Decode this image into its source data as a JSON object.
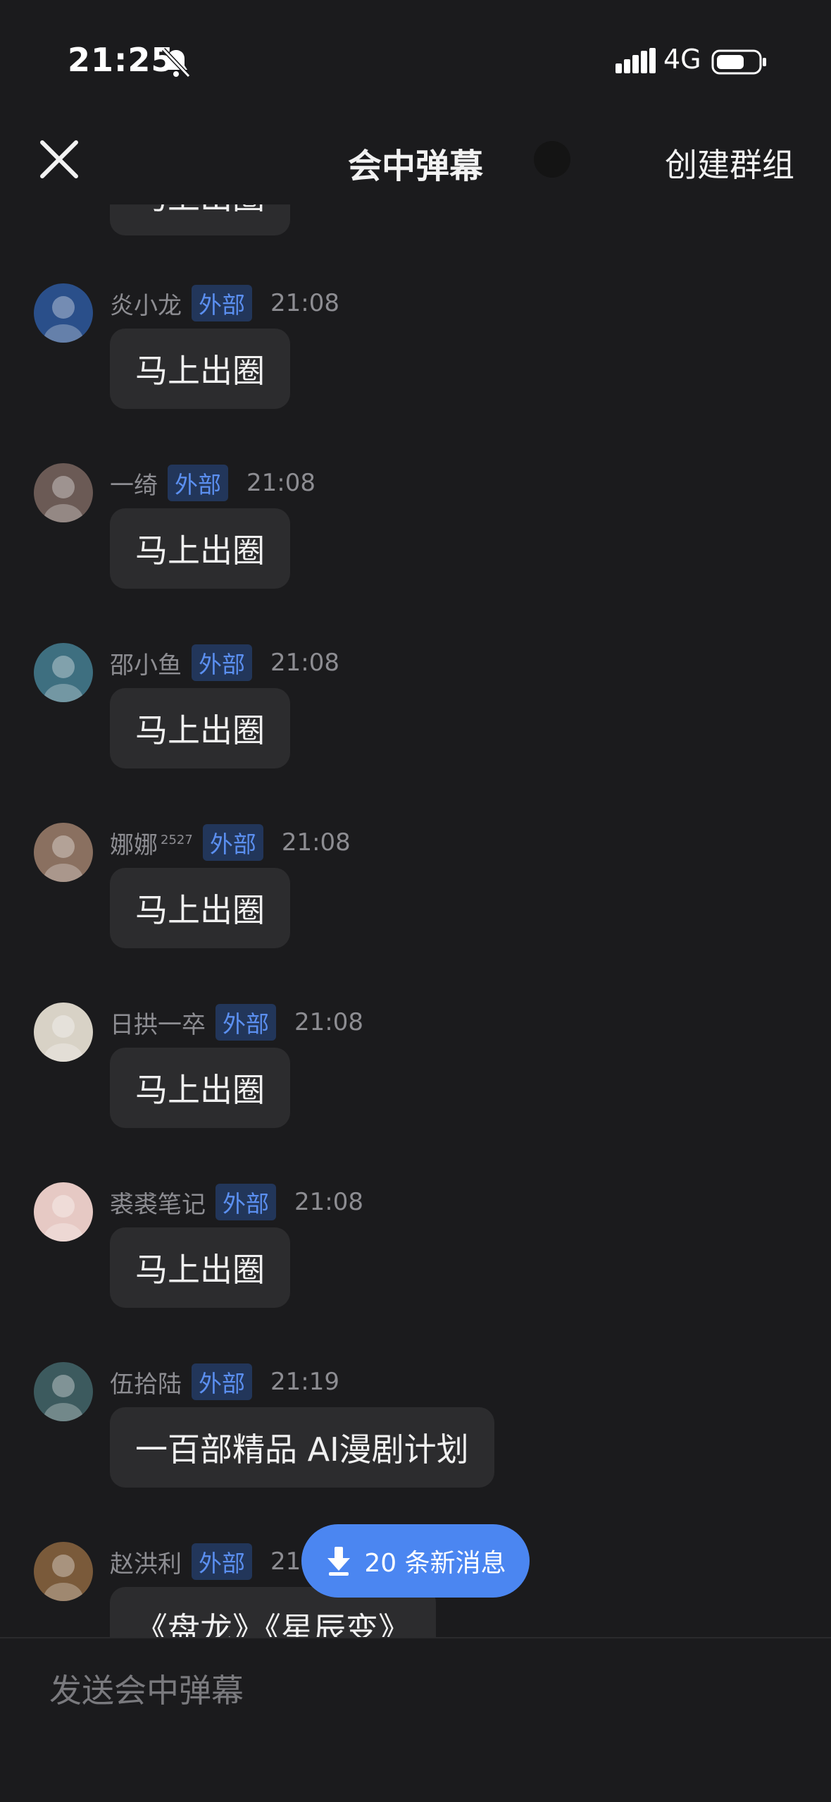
{
  "status": {
    "time": "21:25",
    "network": "4G"
  },
  "nav": {
    "title": "会中弹幕",
    "create_group": "创建群组"
  },
  "partial_top": {
    "text": "马上出圈"
  },
  "messages": [
    {
      "sender": "炎小龙",
      "badge": "外部",
      "time": "21:08",
      "text": "马上出圈",
      "avatar_color": "#2a4f8a"
    },
    {
      "sender": "一绮",
      "badge": "外部",
      "time": "21:08",
      "text": "马上出圈",
      "avatar_color": "#6b5a55"
    },
    {
      "sender": "邵小鱼",
      "badge": "外部",
      "time": "21:08",
      "text": "马上出圈",
      "avatar_color": "#3e6f80"
    },
    {
      "sender": "娜娜",
      "sup": "2527",
      "badge": "外部",
      "time": "21:08",
      "text": "马上出圈",
      "avatar_color": "#8a7060"
    },
    {
      "sender": "日拱一卒",
      "badge": "外部",
      "time": "21:08",
      "text": "马上出圈",
      "avatar_color": "#d8d2c6"
    },
    {
      "sender": "裘裘笔记",
      "badge": "外部",
      "time": "21:08",
      "text": "马上出圈",
      "avatar_color": "#e6c9c4"
    },
    {
      "sender": "伍拾陆",
      "badge": "外部",
      "time": "21:19",
      "text": "一百部精品 AI漫剧计划",
      "avatar_color": "#3c5a5e"
    },
    {
      "sender": "赵洪利",
      "badge": "外部",
      "time": "21",
      "text": "《盘龙》《星辰变》",
      "avatar_color": "#7a5a3a"
    }
  ],
  "new_messages_pill": {
    "label": "20 条新消息"
  },
  "input": {
    "placeholder": "发送会中弹幕"
  }
}
